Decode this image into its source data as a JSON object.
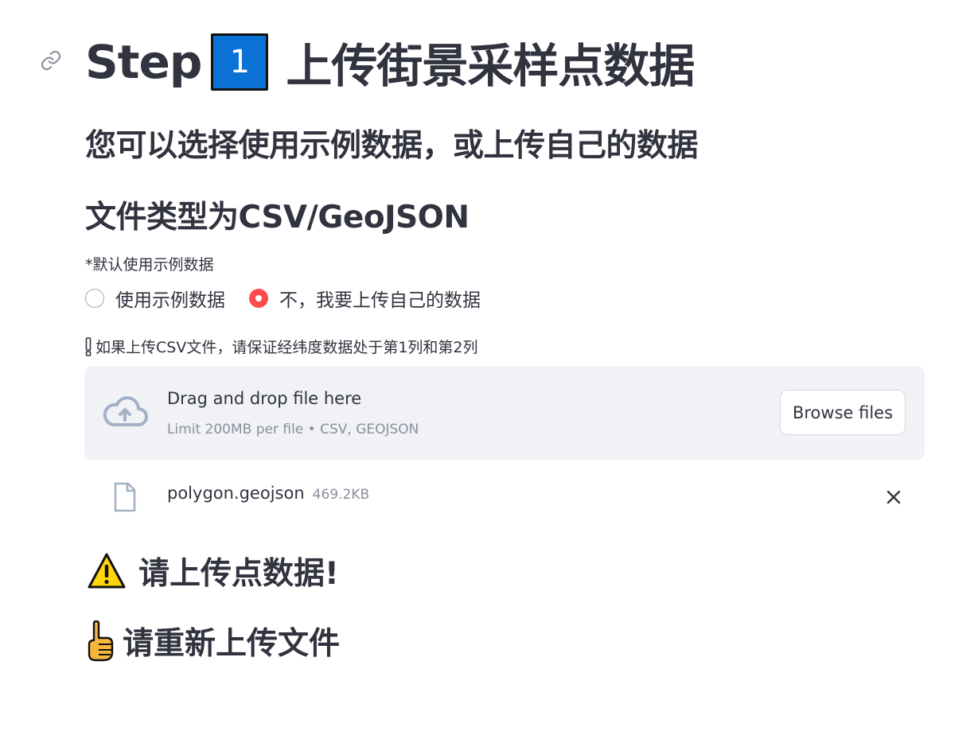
{
  "header": {
    "title_prefix": "Step",
    "keycap_digit": "1",
    "title_suffix": "上传街景采样点数据"
  },
  "subtitles": {
    "line1": "您可以选择使用示例数据，或上传自己的数据",
    "line2": "文件类型为CSV/GeoJSON"
  },
  "radio": {
    "caption": "*默认使用示例数据",
    "options": [
      {
        "label": "使用示例数据",
        "selected": false
      },
      {
        "label": "不，我要上传自己的数据",
        "selected": true
      }
    ]
  },
  "uploader": {
    "caption": "如果上传CSV文件，请保证经纬度数据处于第1列和第2列",
    "drop_title": "Drag and drop file here",
    "drop_subtitle": "Limit 200MB per file • CSV, GEOJSON",
    "browse_label": "Browse files",
    "file": {
      "name": "polygon.geojson",
      "size": "469.2KB"
    }
  },
  "messages": {
    "warning": "请上传点数据!",
    "retry": "请重新上传文件"
  },
  "colors": {
    "accent": "#ff4b4b",
    "keycap_blue": "#0a72d4",
    "dropzone_bg": "#f0f2f6",
    "text": "#31333f",
    "muted": "#8b8f9c",
    "icon_blue_gray": "#a3b1c6"
  },
  "icons": {
    "anchor": "link-icon",
    "keycap": "keycap-1-icon",
    "exclamation": "exclamation-icon",
    "upload": "cloud-upload-icon",
    "file": "file-icon",
    "remove": "close-icon",
    "warning": "warning-icon",
    "pointing": "pointing-up-icon"
  }
}
